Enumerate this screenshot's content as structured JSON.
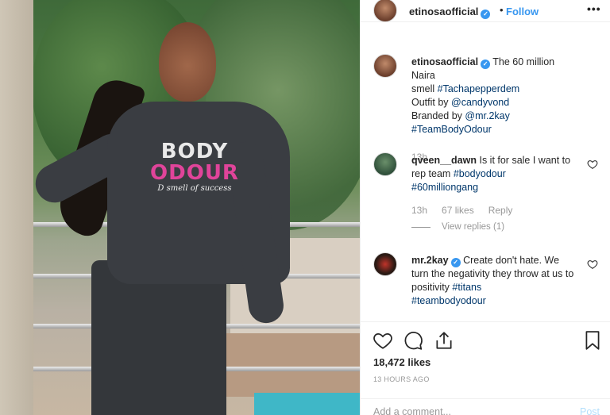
{
  "post": {
    "image_alt": "",
    "shirt": {
      "line1": "BODY",
      "line2": "ODOUR",
      "line3": "D smell of success"
    }
  },
  "header": {
    "username": "etinosaofficial",
    "verified_icon": "verified-badge-icon",
    "separator": "•",
    "follow_label": "Follow",
    "more_icon": "•••"
  },
  "caption": {
    "username": "etinosaofficial",
    "lines": [
      "The 60 million Naira",
      "smell ",
      "#Tachapepperdem",
      "Outfit by ",
      "@candyvond",
      "Branded by ",
      "@mr.2kay",
      "#TeamBodyOdour"
    ],
    "time": "13h"
  },
  "comments": [
    {
      "username": "qveen__dawn",
      "text_a": "Is it for sale I want to rep team ",
      "tag_a": "#bodyodour",
      "tag_b": "#60milliongang",
      "time": "13h",
      "likes": "67 likes",
      "reply_label": "Reply",
      "view_replies": "View replies (1)"
    },
    {
      "username": "mr.2kay",
      "text_a": "Create don't hate. We turn the negativity they throw at us to positivity ",
      "tag_a": "#titans",
      "tag_b": "#teambodyodour"
    }
  ],
  "actions": {
    "like_icon": "heart-icon",
    "comment_icon": "comment-icon",
    "share_icon": "share-icon",
    "save_icon": "bookmark-icon",
    "likes_count": "18,472 likes",
    "timestamp": "13 HOURS AGO"
  },
  "add_comment": {
    "placeholder": "Add a comment...",
    "post_label": "Post"
  },
  "colors": {
    "link_blue": "#3897f0",
    "tag_blue": "#00376b",
    "muted": "#999999",
    "shirt_pink": "#e0449a"
  }
}
